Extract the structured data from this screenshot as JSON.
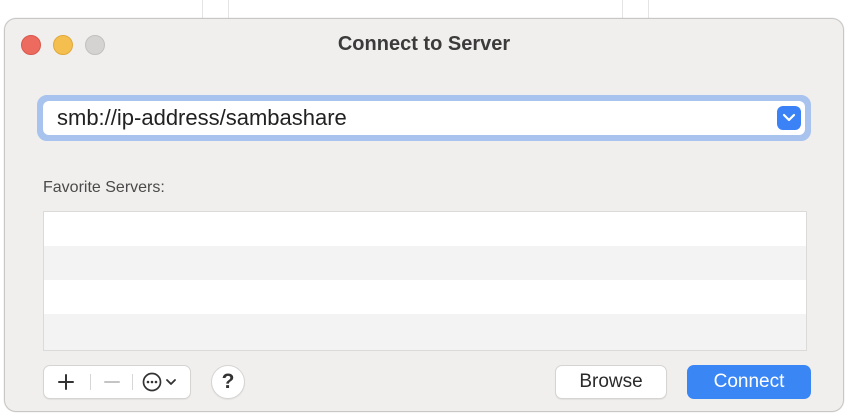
{
  "window": {
    "title": "Connect to Server"
  },
  "address": {
    "value": "smb://ip-address/sambashare",
    "placeholder": ""
  },
  "favorites": {
    "label": "Favorite Servers:",
    "items": []
  },
  "toolbar": {
    "add_icon": "plus-icon",
    "remove_icon": "minus-icon",
    "more_icon": "ellipsis-circle-icon",
    "chevron_icon": "chevron-down-icon",
    "help_label": "?",
    "browse_label": "Browse",
    "connect_label": "Connect"
  },
  "colors": {
    "accent": "#3a86f5",
    "focus_ring": "#a7c3ee",
    "close": "#ed6a5e",
    "minimize": "#f5bf4f",
    "zoom_disabled": "#d5d3d1",
    "window_bg": "#f1efed",
    "list_alt_row": "#f3f3f3"
  }
}
